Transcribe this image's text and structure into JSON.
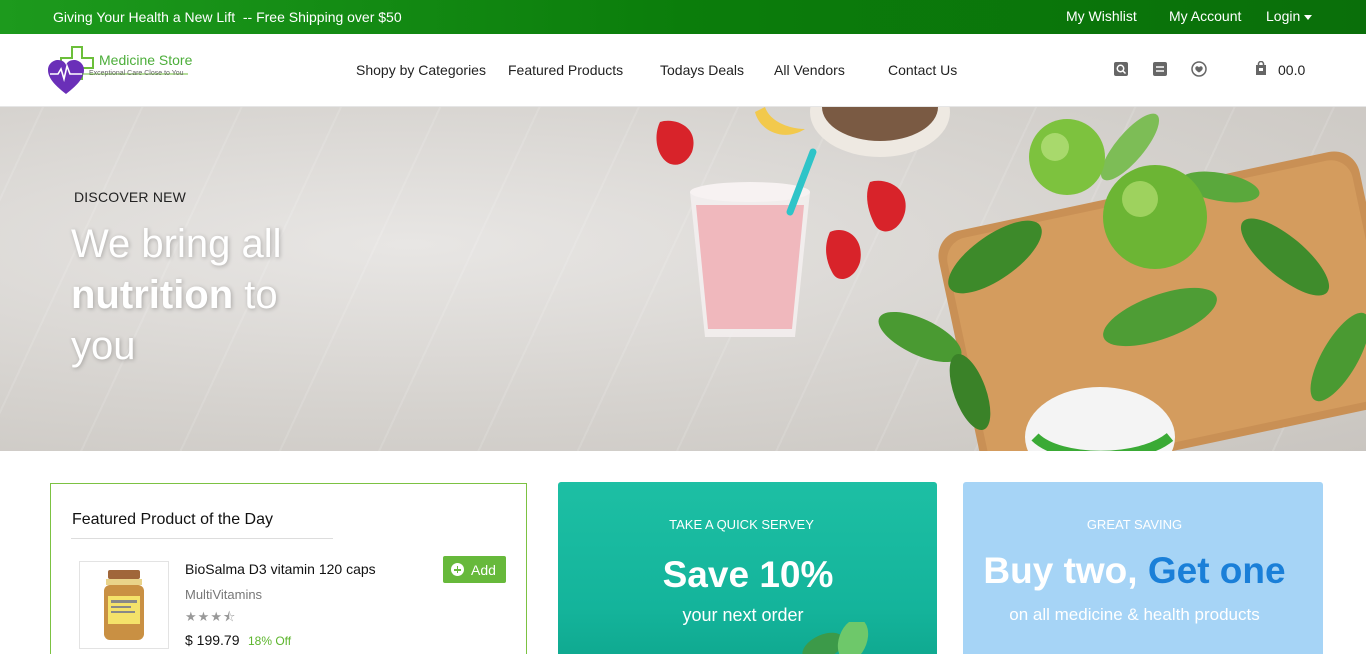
{
  "topbar": {
    "promo": "Giving Your Health a New Lift  -- Free Shipping over $50",
    "wishlist": "My Wishlist",
    "account": "My Account",
    "login": "Login"
  },
  "header": {
    "logo_name": "Medicine Store",
    "logo_tagline": "Exceptional Care Close to You",
    "nav": [
      "Shopy by Categories",
      "Featured Products",
      "Todays Deals",
      "All Vendors",
      "Contact Us"
    ],
    "icons": [
      "search-icon",
      "menu-icon",
      "heart-icon",
      "cart-icon"
    ],
    "cart_total": "00.0"
  },
  "hero": {
    "kicker": "DISCOVER NEW",
    "line1": "We bring all",
    "line2_bold": "nutrition",
    "line2_rest": " to",
    "line3": "you"
  },
  "featured": {
    "title": "Featured Product of the Day",
    "product_name": "BioSalma D3 vitamin 120 caps",
    "category": "MultiVitamins",
    "rating": 3.5,
    "rating_max": 5,
    "price": "$ 199.79",
    "discount": "18% Off",
    "add_label": "Add"
  },
  "promo_teal": {
    "kicker": "TAKE A QUICK SERVEY",
    "headline": "Save 10%",
    "sub": "your next order"
  },
  "promo_blue": {
    "kicker": "GREAT SAVING",
    "headline_a": "Buy two, ",
    "headline_b": "Get one",
    "sub": "on all medicine & health products"
  },
  "colors": {
    "topbar": "#0b7d0b",
    "accent_green": "#67b93b",
    "teal": "#14b49b",
    "blue_card": "#a6d4f6",
    "blue_highlight": "#1a7fd8"
  }
}
